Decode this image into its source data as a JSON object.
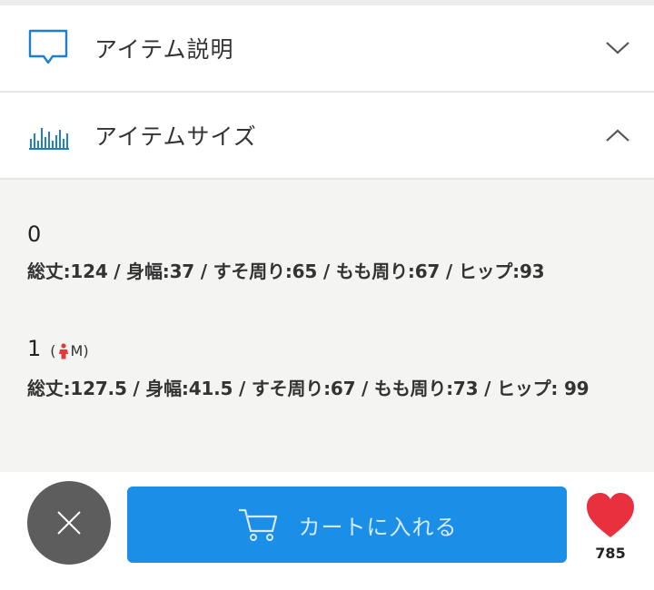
{
  "accordion": {
    "description_label": "アイテム説明",
    "size_label": "アイテムサイズ"
  },
  "sizes": [
    {
      "name": "0",
      "model_tag": "",
      "measures": "総丈:124 / 身幅:37 / すそ周り:65 / もも周り:67 / ヒップ:93"
    },
    {
      "name": "1",
      "model_tag_open": "(",
      "model_tag_size": "M)",
      "measures": "総丈:127.5 / 身幅:41.5 / すそ周り:67 / もも周り:73 / ヒップ: 99"
    }
  ],
  "actions": {
    "cart_label": "カートに入れる",
    "like_count": "785"
  },
  "colors": {
    "cart_button": "#1b8fe8",
    "close_button": "#5d5d5d",
    "heart": "#e8303f",
    "icon_blue": "#1f7fcf",
    "panel_bg": "#f4f4f3"
  }
}
